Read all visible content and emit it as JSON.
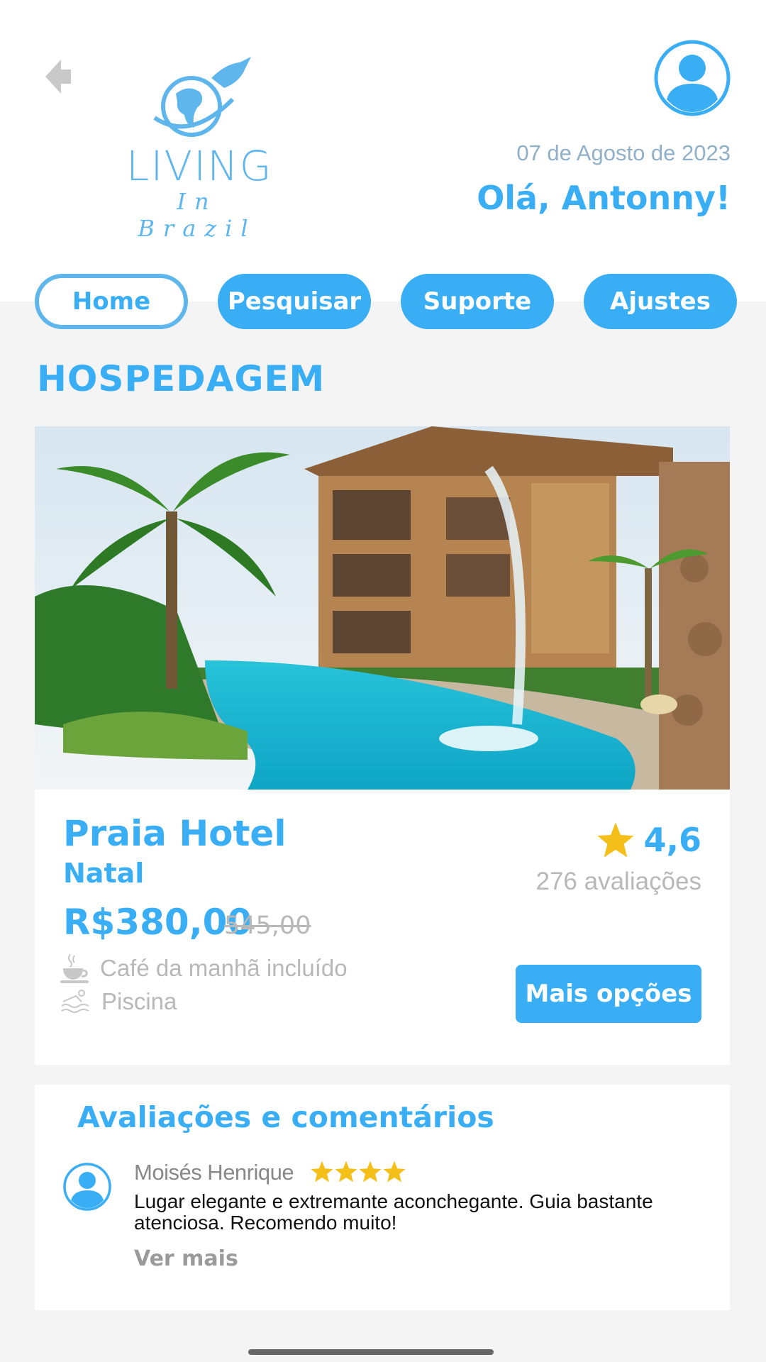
{
  "header": {
    "logo": {
      "word": "LIVING",
      "sub": "In Brazil"
    },
    "date": "07 de Agosto de 2023",
    "greeting": "Olá, Antonny!"
  },
  "nav": {
    "items": [
      {
        "label": "Home",
        "active": true
      },
      {
        "label": "Pesquisar",
        "active": false
      },
      {
        "label": "Suporte",
        "active": false
      },
      {
        "label": "Ajustes",
        "active": false
      }
    ]
  },
  "section": {
    "title": "HOSPEDAGEM"
  },
  "hotel": {
    "name": "Praia Hotel",
    "city": "Natal",
    "price": "R$380,00",
    "old_price": "545,00",
    "rating": "4,6",
    "rating_count": "276 avaliações",
    "amenities": [
      {
        "icon": "coffee-cup-icon",
        "label": "Café da manhã incluído"
      },
      {
        "icon": "pool-icon",
        "label": "Piscina"
      }
    ],
    "more_button": "Mais opções"
  },
  "reviews": {
    "title": "Avaliações e comentários",
    "items": [
      {
        "author": "Moisés Henrique",
        "stars": 4,
        "text": "Lugar elegante e extremante aconchegante. Guia bastante atenciosa. Recomendo muito!",
        "see_more": "Ver mais"
      }
    ]
  },
  "colors": {
    "accent": "#3aaef5",
    "star": "#f5bf1a",
    "muted": "#b8b8b8",
    "background": "#f4f4f4"
  }
}
